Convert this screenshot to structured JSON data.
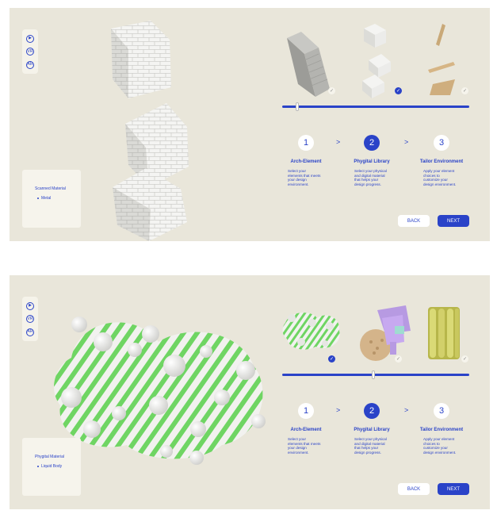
{
  "toolbar_icons": [
    "play-icon",
    "vr-icon",
    "ar-icon"
  ],
  "toolbar_labels": [
    "▶",
    "VR",
    "AR"
  ],
  "screens": [
    {
      "material_title": "Scanned Material",
      "material_item": "Metal",
      "slider_value_pct": 8,
      "selected_thumb": 1
    },
    {
      "material_title": "Phygital Material",
      "material_item": "Liquid Body",
      "slider_value_pct": 50,
      "selected_thumb": 0
    }
  ],
  "steps": [
    {
      "num": "1",
      "title": "Arch-Element",
      "desc1": "Select your elements that meets your design environment.",
      "desc2": "Select your elements that meets your design environment."
    },
    {
      "num": "2",
      "title": "Phygital Library",
      "desc1": "Select your physical and digital material that helps your design progress.",
      "desc2": "Select your physical and digital material that helps your design progress."
    },
    {
      "num": "3",
      "title": "Tailor Environment",
      "desc1": "Apply your element choices to customize your design environment.",
      "desc2": "Apply your element choices to customize your design environment."
    }
  ],
  "chevron": ">",
  "buttons": {
    "back": "BACK",
    "next": "NEXT"
  },
  "check_mark": "✓",
  "colors": {
    "accent": "#2a43c8",
    "panel": "#e9e6da",
    "card": "#f6f4ec",
    "green": "#6fd563"
  }
}
